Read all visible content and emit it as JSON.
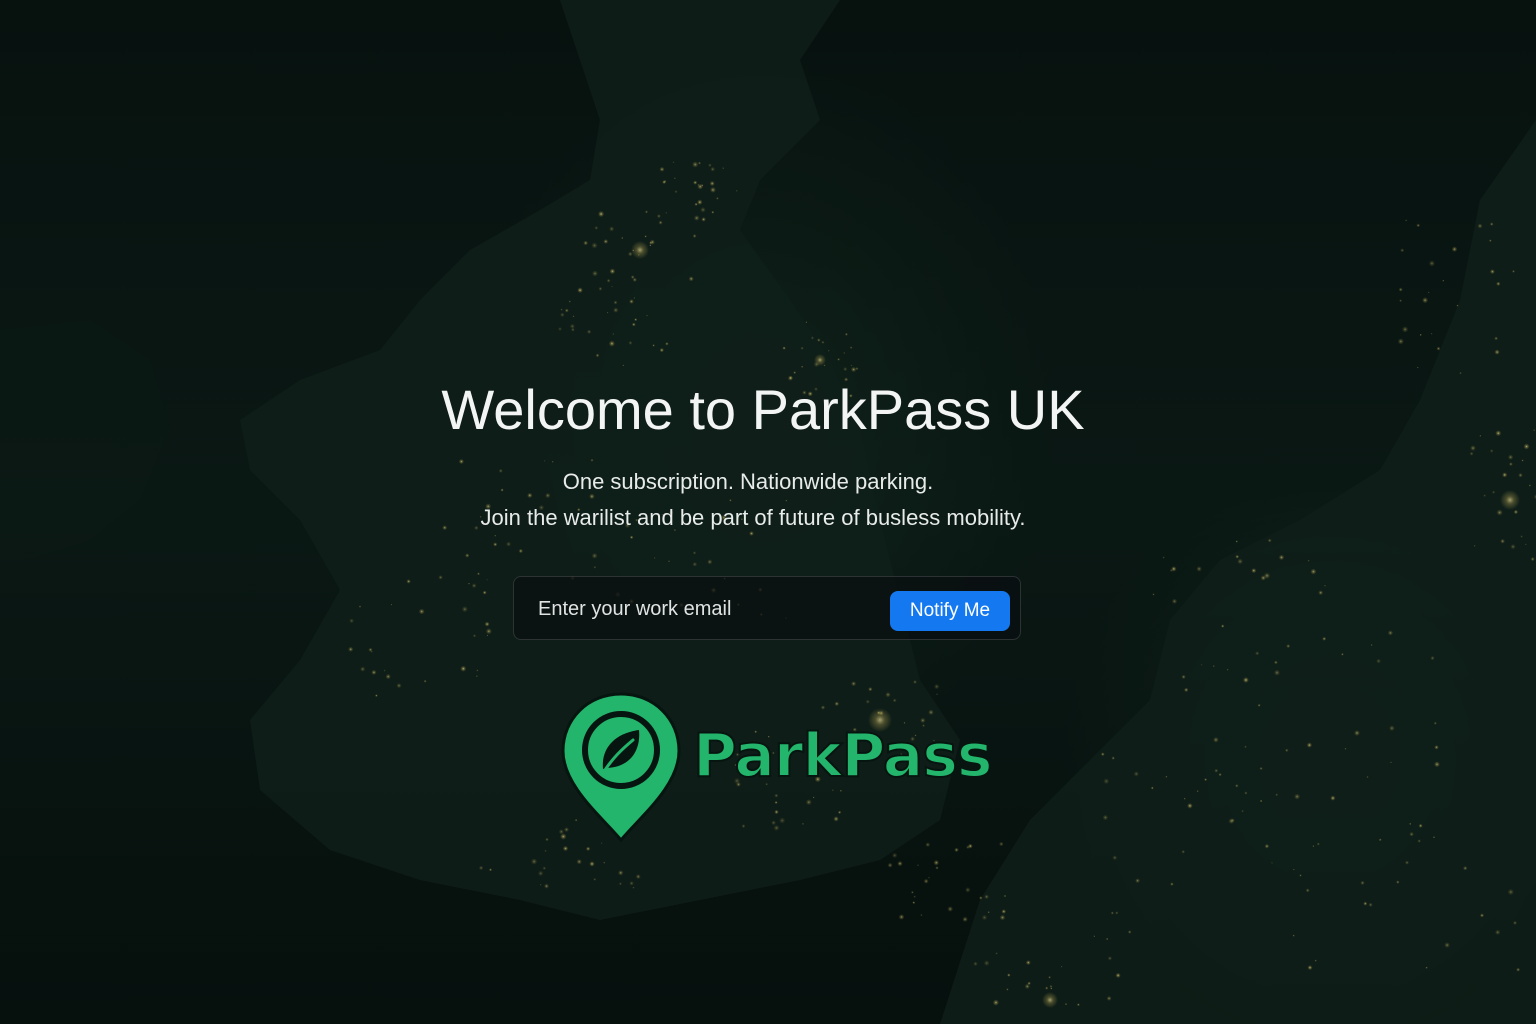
{
  "hero": {
    "title": "Welcome to ParkPass UK",
    "subtitle_line1": "One subscription. Nationwide parking.",
    "subtitle_line2": "Join the warilist and be part of future of busless mobility."
  },
  "signup": {
    "email_placeholder": "Enter your work email",
    "email_value": "",
    "button_label": "Notify Me"
  },
  "brand": {
    "logo_text": "ParkPass",
    "logo_icon": "map-pin-leaf-icon",
    "brand_color": "#22b56b",
    "button_color": "#1479f0"
  },
  "background": {
    "image": "night-satellite-map-of-uk-city-lights"
  }
}
